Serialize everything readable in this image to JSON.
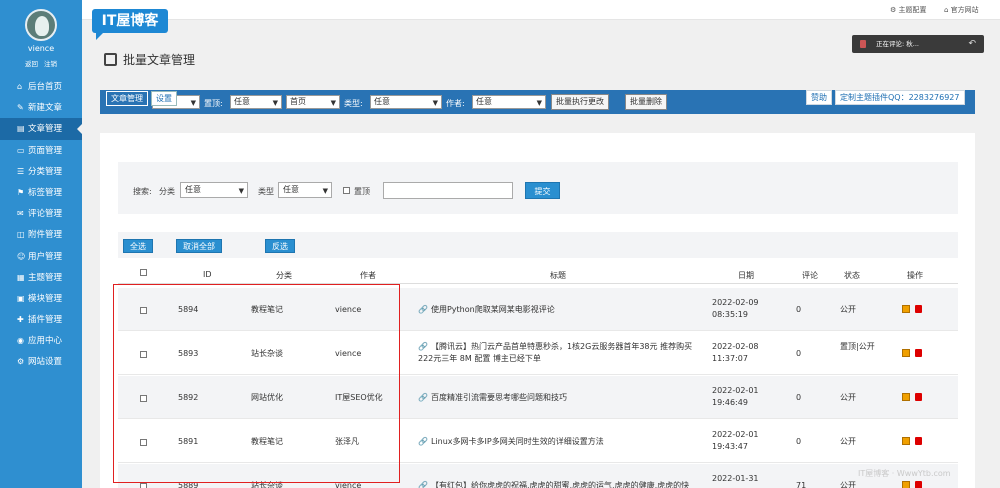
{
  "user": {
    "name": "vience",
    "links": [
      "返回",
      "注销"
    ]
  },
  "sidebar": {
    "items": [
      {
        "icon": "home-icon",
        "glyph": "⌂",
        "label": "后台首页"
      },
      {
        "icon": "add-icon",
        "glyph": "✎",
        "label": "新建文章"
      },
      {
        "icon": "article-icon",
        "glyph": "▤",
        "label": "文章管理"
      },
      {
        "icon": "page-icon",
        "glyph": "▭",
        "label": "页面管理"
      },
      {
        "icon": "category-icon",
        "glyph": "☰",
        "label": "分类管理"
      },
      {
        "icon": "tag-icon",
        "glyph": "⚑",
        "label": "标签管理"
      },
      {
        "icon": "comment-icon",
        "glyph": "✉",
        "label": "评论管理"
      },
      {
        "icon": "attachment-icon",
        "glyph": "◫",
        "label": "附件管理"
      },
      {
        "icon": "user-icon",
        "glyph": "☺",
        "label": "用户管理"
      },
      {
        "icon": "theme-icon",
        "glyph": "▦",
        "label": "主题管理"
      },
      {
        "icon": "module-icon",
        "glyph": "▣",
        "label": "模块管理"
      },
      {
        "icon": "plugin-icon",
        "glyph": "✚",
        "label": "插件管理"
      },
      {
        "icon": "app-icon",
        "glyph": "◉",
        "label": "应用中心"
      },
      {
        "icon": "settings-icon",
        "glyph": "⚙",
        "label": "网站设置"
      }
    ]
  },
  "topbar": {
    "theme_config": "主题配置",
    "official_site": "官方网站"
  },
  "logo": {
    "text": "IT屋博客"
  },
  "page": {
    "title": "批量文章管理"
  },
  "status": {
    "text": "正在评论: 秋..."
  },
  "tabs": [
    "文章管理",
    "设置"
  ],
  "bulk": {
    "top_label": "置顶:",
    "top_value": "任意",
    "pos_value": "首页",
    "type_label": "类型:",
    "type_value": "任意",
    "author_label": "作者:",
    "author_value": "任意",
    "apply_button": "批量执行更改",
    "delete_button": "批量删除"
  },
  "right_links": [
    "赞助",
    "定制主题插件QQ：2283276927"
  ],
  "search": {
    "label": "搜索:",
    "category_label": "分类",
    "category_value": "任意",
    "type_label": "类型",
    "type_value": "任意",
    "top_label": "置顶",
    "submit": "提交"
  },
  "actions": [
    "全选",
    "取消全部",
    "反选"
  ],
  "table": {
    "headers": {
      "id": "ID",
      "category": "分类",
      "author": "作者",
      "title": "标题",
      "date": "日期",
      "comments": "评论",
      "status": "状态",
      "ops": "操作"
    },
    "rows": [
      {
        "id": "5894",
        "category": "教程笔记",
        "author": "vience",
        "title": "使用Python爬取某网某电影视评论",
        "date1": "2022-02-09",
        "date2": "08:35:19",
        "comments": "0",
        "status": "公开"
      },
      {
        "id": "5893",
        "category": "站长杂谈",
        "author": "vience",
        "title": "【腾讯云】热门云产品首单特惠秒杀，1核2G云服务器首年38元 推荐购买222元三年 8M 配置 博主已经下单",
        "date1": "2022-02-08",
        "date2": "11:37:07",
        "comments": "0",
        "status": "置顶|公开"
      },
      {
        "id": "5892",
        "category": "网站优化",
        "author": "IT屋SEO优化",
        "title": "百度精准引流需要思考哪些问题和技巧",
        "date1": "2022-02-01",
        "date2": "19:46:49",
        "comments": "0",
        "status": "公开"
      },
      {
        "id": "5891",
        "category": "教程笔记",
        "author": "张泽凡",
        "title": "Linux多网卡多IP多网关同时生效的详细设置方法",
        "date1": "2022-02-01",
        "date2": "19:43:47",
        "comments": "0",
        "status": "公开"
      },
      {
        "id": "5889",
        "category": "站长杂谈",
        "author": "vience",
        "title": "【有红包】给你虎虎的祝福,虎虎的甜蜜,虎虎的运气,虎虎的健康,虎虎的快",
        "date1": "2022-01-31",
        "date2": "",
        "comments": "71",
        "status": "公开"
      }
    ]
  },
  "watermark": "IT屋博客 · WwwYtb.com"
}
